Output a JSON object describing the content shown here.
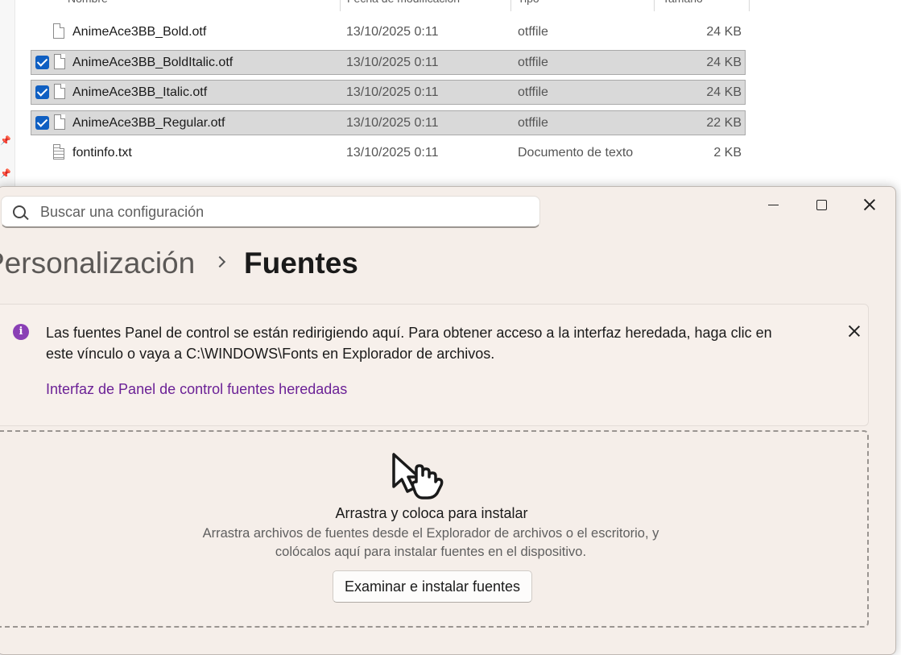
{
  "explorer": {
    "columns": {
      "name": "Nombre",
      "date": "Fecha de modificación",
      "type": "Tipo",
      "size": "Tamaño"
    },
    "files": [
      {
        "name": "AnimeAce3BB_Bold.otf",
        "date": "13/10/2025 0:11",
        "type": "otffile",
        "size": "24 KB",
        "selected": false
      },
      {
        "name": "AnimeAce3BB_BoldItalic.otf",
        "date": "13/10/2025 0:11",
        "type": "otffile",
        "size": "24 KB",
        "selected": true
      },
      {
        "name": "AnimeAce3BB_Italic.otf",
        "date": "13/10/2025 0:11",
        "type": "otffile",
        "size": "24 KB",
        "selected": true
      },
      {
        "name": "AnimeAce3BB_Regular.otf",
        "date": "13/10/2025 0:11",
        "type": "otffile",
        "size": "22 KB",
        "selected": true
      },
      {
        "name": "fontinfo.txt",
        "date": "13/10/2025 0:11",
        "type": "Documento de texto",
        "size": "2 KB",
        "selected": false
      }
    ]
  },
  "settings": {
    "search": {
      "placeholder": "Buscar una configuración",
      "value": ""
    },
    "breadcrumb": {
      "parent": "Personalización",
      "current": "Fuentes"
    },
    "info": {
      "text": "Las fuentes Panel de control se están redirigiendo aquí. Para obtener acceso a la interfaz heredada, haga clic en este vínculo o vaya a C:\\WINDOWS\\Fonts en Explorador de archivos.",
      "link": "Interfaz de Panel de control fuentes heredadas"
    },
    "drop": {
      "title": "Arrastra y coloca para instalar",
      "description": "Arrastra archivos de fuentes desde el Explorador de archivos o el escritorio, y colócalos aquí para instalar fuentes en el dispositivo.",
      "button": "Examinar e instalar fuentes"
    }
  },
  "colors": {
    "accent": "#0f5fc2",
    "link": "#6b2196",
    "info_icon": "#8a3fb5",
    "settings_bg": "#f5eee9"
  }
}
